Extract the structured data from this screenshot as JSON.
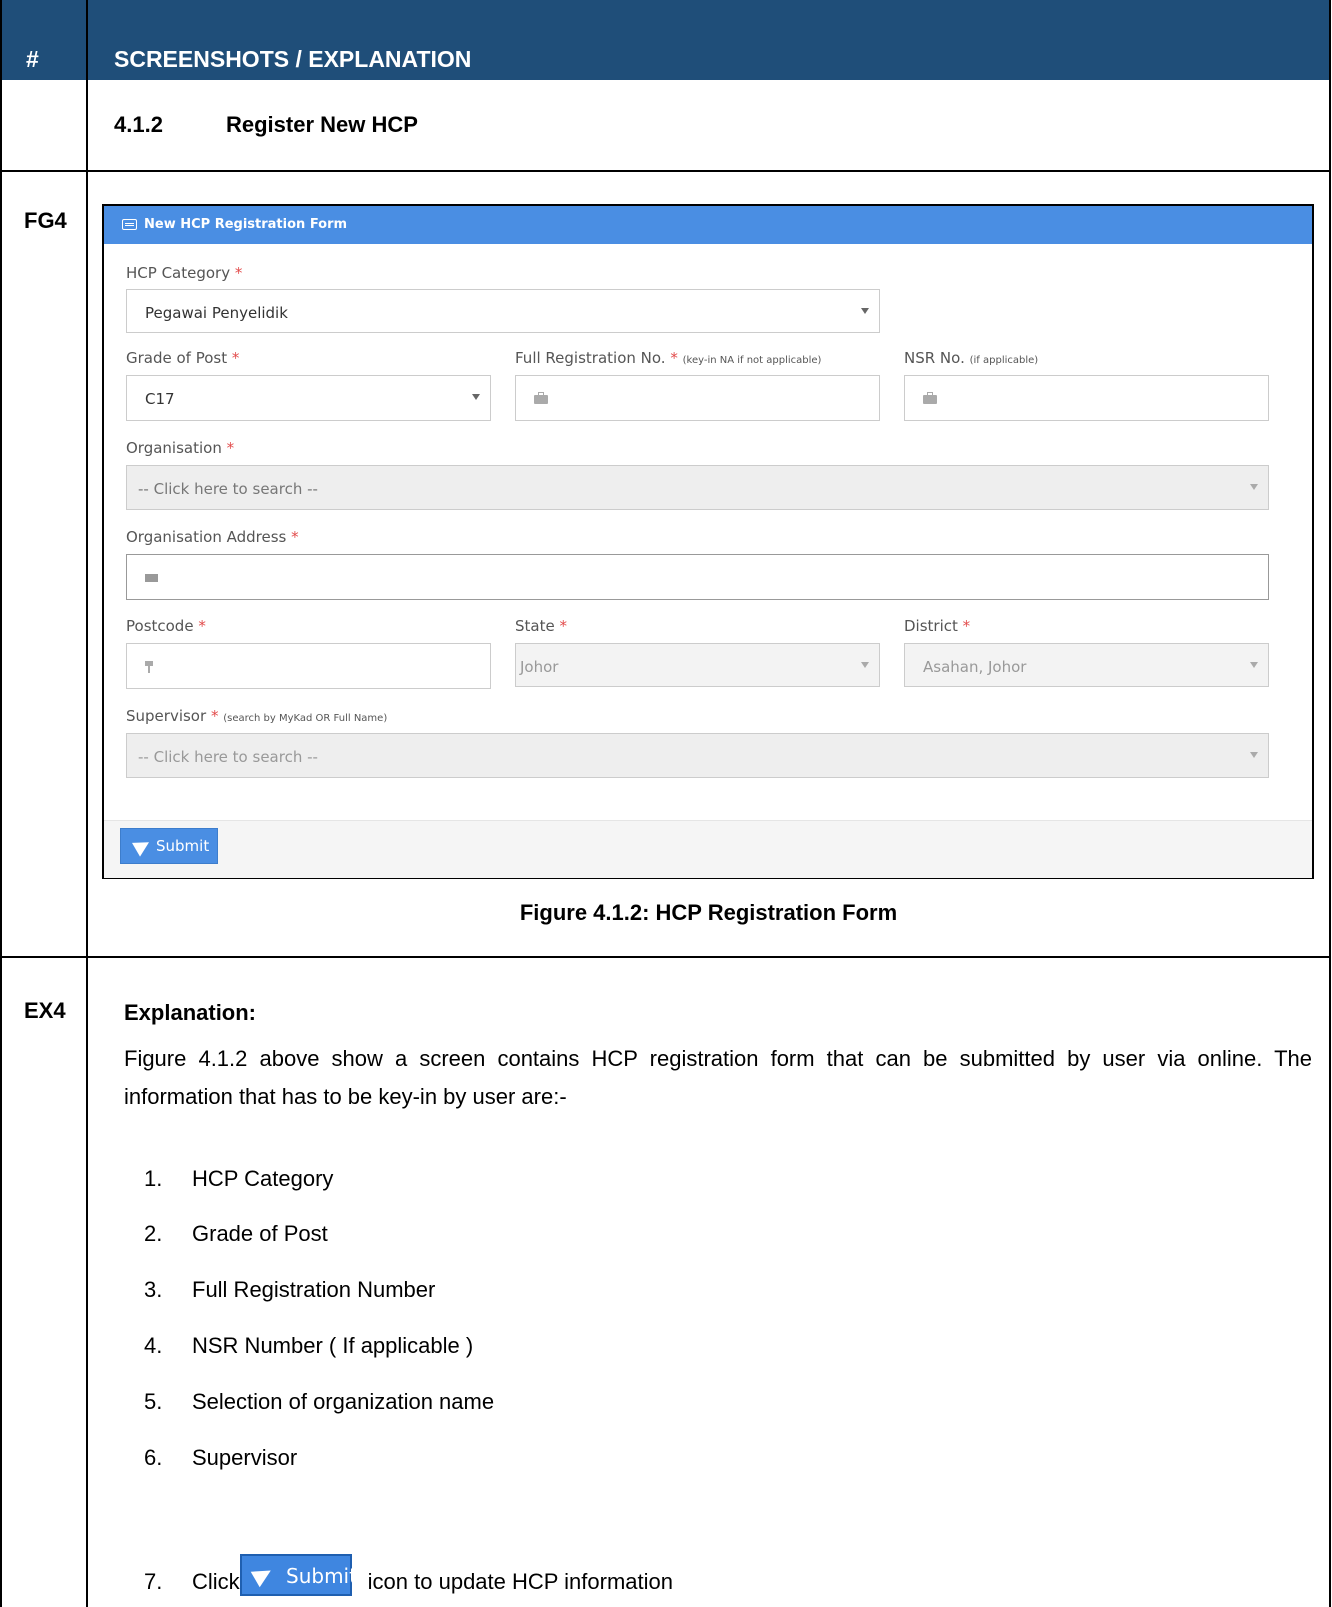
{
  "header": {
    "col1": "#",
    "col2": "SCREENSHOTS / EXPLANATION"
  },
  "section": {
    "number": "4.1.2",
    "title": "Register New HCP"
  },
  "rows": {
    "figure_id": "FG4",
    "explanation_id": "EX4"
  },
  "form": {
    "panel_title": "New HCP Registration Form",
    "hcp_category": {
      "label": "HCP Category",
      "required": "*",
      "value": "Pegawai Penyelidik"
    },
    "grade_of_post": {
      "label": "Grade of Post",
      "required": "*",
      "value": "C17"
    },
    "full_registration": {
      "label": "Full Registration No.",
      "required": "*",
      "hint": "(key-in NA if not applicable)",
      "value": ""
    },
    "nsr": {
      "label": "NSR No.",
      "hint": "(if applicable)",
      "value": ""
    },
    "organisation": {
      "label": "Organisation",
      "required": "*",
      "placeholder": "-- Click here to search --"
    },
    "organisation_address": {
      "label": "Organisation Address",
      "required": "*",
      "value": ""
    },
    "postcode": {
      "label": "Postcode",
      "required": "*",
      "value": ""
    },
    "state": {
      "label": "State",
      "required": "*",
      "value": "Johor"
    },
    "district": {
      "label": "District",
      "required": "*",
      "value": "Asahan, Johor"
    },
    "supervisor": {
      "label": "Supervisor",
      "required": "*",
      "hint": "(search by MyKad OR Full Name)",
      "placeholder": "-- Click here to search --"
    },
    "submit_label": "Submit"
  },
  "caption": "Figure 4.1.2: HCP Registration Form",
  "explanation": {
    "title": "Explanation:",
    "paragraph": "Figure 4.1.2 above show a screen contains HCP registration form that can be submitted by user via online. The information that has to be key-in by user are:-",
    "items": [
      {
        "n": "1.",
        "text": "HCP Category"
      },
      {
        "n": "2.",
        "text": "Grade of Post"
      },
      {
        "n": "3.",
        "text": "Full Registration Number"
      },
      {
        "n": "4.",
        "text": "NSR Number ( If applicable )"
      },
      {
        "n": "5.",
        "text": "Selection of organization name"
      },
      {
        "n": "6.",
        "text": "Supervisor"
      }
    ],
    "last_item": {
      "n": "7.",
      "pre": "Click",
      "button": "Submit",
      "post": "icon to update HCP information"
    }
  },
  "colors": {
    "header_bg": "#1f4e79",
    "panel_header": "#4a8ee3",
    "required": "#e24b4b"
  }
}
